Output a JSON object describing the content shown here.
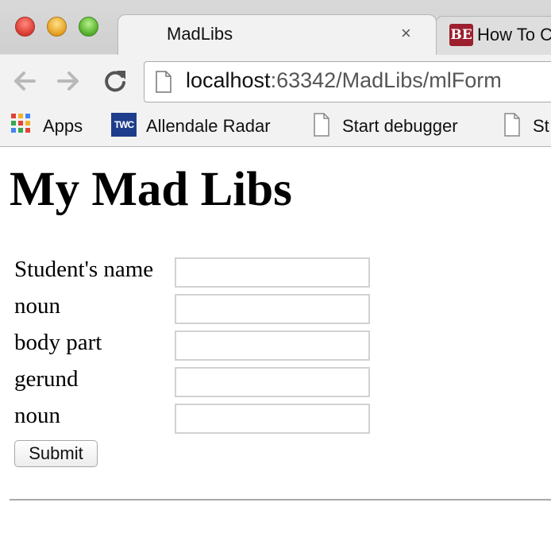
{
  "browser": {
    "tabs": [
      {
        "title": "MadLibs",
        "close_icon": "×"
      },
      {
        "favicon_text": "BE",
        "title": "How To C"
      }
    ],
    "url": {
      "host": "localhost",
      "rest": ":63342/MadLibs/mlForm"
    },
    "bookmarks": [
      {
        "label": "Apps"
      },
      {
        "label": "Allendale Radar",
        "icon_text": "TWC"
      },
      {
        "label": "Start debugger"
      },
      {
        "label": "St"
      }
    ]
  },
  "page": {
    "title": "My Mad Libs",
    "fields": [
      {
        "label": "Student's name",
        "value": ""
      },
      {
        "label": "noun",
        "value": ""
      },
      {
        "label": "body part",
        "value": ""
      },
      {
        "label": "gerund",
        "value": ""
      },
      {
        "label": "noun",
        "value": ""
      }
    ],
    "submit_label": "Submit"
  },
  "colors": {
    "be_favicon": "#9c1f2e",
    "twc_icon": "#1e3d8c"
  }
}
